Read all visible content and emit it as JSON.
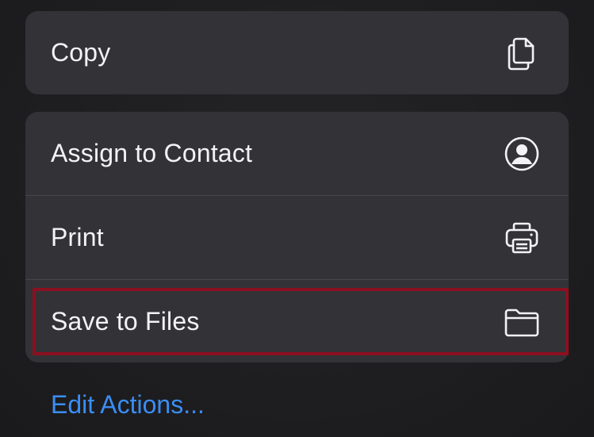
{
  "menu": {
    "group1": [
      {
        "label": "Copy",
        "icon": "copy-icon"
      }
    ],
    "group2": [
      {
        "label": "Assign to Contact",
        "icon": "person-circle-icon"
      },
      {
        "label": "Print",
        "icon": "printer-icon"
      },
      {
        "label": "Save to Files",
        "icon": "folder-icon"
      }
    ],
    "edit_actions": "Edit Actions..."
  },
  "colors": {
    "background": "#1c1c1e",
    "row": "#333337",
    "text": "#f2f2f7",
    "accent": "#3a8ef5",
    "highlight": "#8b1020"
  }
}
